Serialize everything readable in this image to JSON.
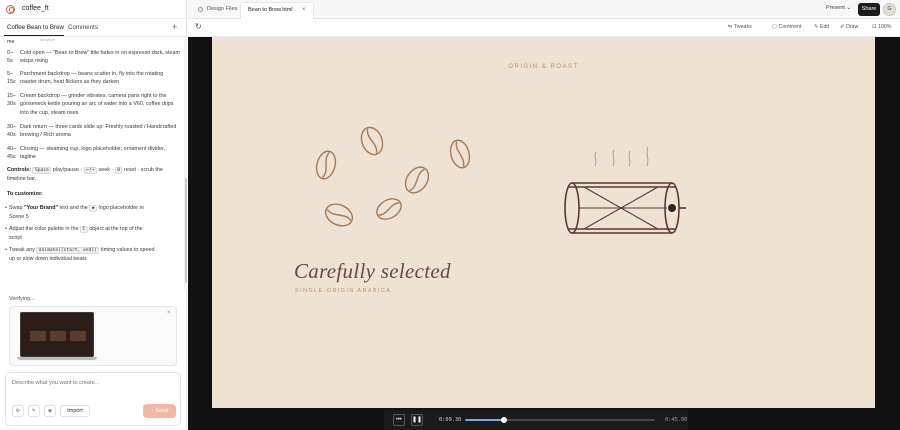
{
  "app": {
    "project_name": "coffee_ft"
  },
  "left_tabs": {
    "tab1": "Coffee Bean to Brew",
    "tab2": "Comments",
    "add": "+"
  },
  "chat": {
    "faded_header": "storyline",
    "cut_word": "me",
    "timeline": [
      {
        "time": "0–\n5s",
        "desc": "Cold open — \"Bean to Brew\" title fades in on espresso dark, steam wisps rising"
      },
      {
        "time": "5–\n15s",
        "desc": "Parchment backdrop — beans scatter in, fly into the rotating roaster drum, heat flickers as they darken"
      },
      {
        "time": "15–\n30s",
        "desc": "Cream backdrop — grinder vibrates, camera pans right to the gooseneck kettle pouring an arc of water into a V60, coffee drips into the cup, steam rises"
      },
      {
        "time": "30–\n40s",
        "desc": "Dark return — three cards slide up: Freshly roasted / Handcrafted brewing / Rich aroma"
      },
      {
        "time": "40–\n45s",
        "desc": "Closing — steaming cup, logo placeholder, ornament divider, tagline"
      }
    ],
    "controls_label": "Controls:",
    "controls_key_space": "Space",
    "controls_text_1": "play/pause ·",
    "controls_key_arrows": "←/→",
    "controls_text_2": "seek ·",
    "controls_key_zero": "0",
    "controls_text_3": "reset · scrub the",
    "controls_text_4": "timeline bar.",
    "customize_heading": "To customize:",
    "bullets": [
      {
        "pre": "Swap ",
        "strong": "\"Your Brand\"",
        "mid": " text and the ",
        "code": "◆",
        "post": " logo placeholder in",
        "line2": "Scene 5"
      },
      {
        "pre": "Adjust the color palette in the ",
        "code": "C",
        "post": " object at the top of the",
        "line2": "script"
      },
      {
        "pre": "Tweak any ",
        "code": "animate([start, end])",
        "post": " timing values to speed",
        "line2": "up or slow down individual beats"
      }
    ],
    "verifying": "Verifying..."
  },
  "composer": {
    "placeholder": "Describe what you want to create...",
    "import_label": "Import",
    "send_label": "Send"
  },
  "file_tabs": {
    "tab1": "Design Files",
    "tab2": "Bean to Brew.html",
    "close": "×"
  },
  "header": {
    "present": "Present",
    "share": "Share",
    "avatar_letter": "G"
  },
  "toolbar": {
    "tweaks": "Tweaks",
    "comment": "Comment",
    "edit": "Edit",
    "draw": "Draw",
    "zoom": "100%"
  },
  "slide": {
    "eyebrow": "ORIGIN & ROAST",
    "headline": "Carefully selected",
    "subline": "SINGLE-ORIGIN ARABICA"
  },
  "player": {
    "current_time": "0:09.30",
    "total_time": "0:45.00",
    "progress": 0.207
  },
  "colors": {
    "accent": "#c08c5f",
    "ink": "#6b4a3a",
    "send": "#f2b7a6",
    "progress": "#7aa7e6"
  }
}
